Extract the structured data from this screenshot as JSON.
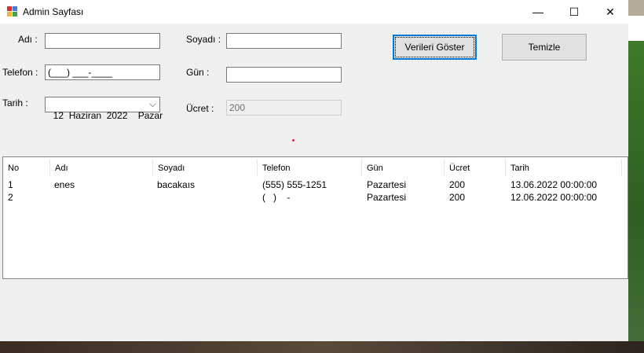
{
  "window": {
    "title": "Admin Sayfası",
    "controls": {
      "minimize": "—",
      "maximize": "☐",
      "close": "✕"
    }
  },
  "form": {
    "ad_label": "Adı :",
    "ad_value": "",
    "soyad_label": "Soyadı :",
    "soyad_value": "",
    "telefon_label": "Telefon :",
    "telefon_value": "(___) ___-____",
    "gun_label": "Gün :",
    "gun_value": "",
    "tarih_label": "Tarih :",
    "tarih_value": "12  Haziran  2022    Pazar",
    "ucret_label": "Ücret :",
    "ucret_value": "200"
  },
  "buttons": {
    "show": "Verileri Göster",
    "clear": "Temizle"
  },
  "table": {
    "columns": [
      "No",
      "Adı",
      "Soyadı",
      "Telefon",
      "Gün",
      "Ücret",
      "Tarih"
    ],
    "rows": [
      [
        "1",
        "enes",
        "bacakaıs",
        "(555) 555-1251",
        "Pazartesi",
        "200",
        "13.06.2022 00:00:00"
      ],
      [
        "2",
        "",
        "",
        "(   )    -",
        "Pazartesi",
        "200",
        "12.06.2022 00:00:00"
      ]
    ]
  }
}
